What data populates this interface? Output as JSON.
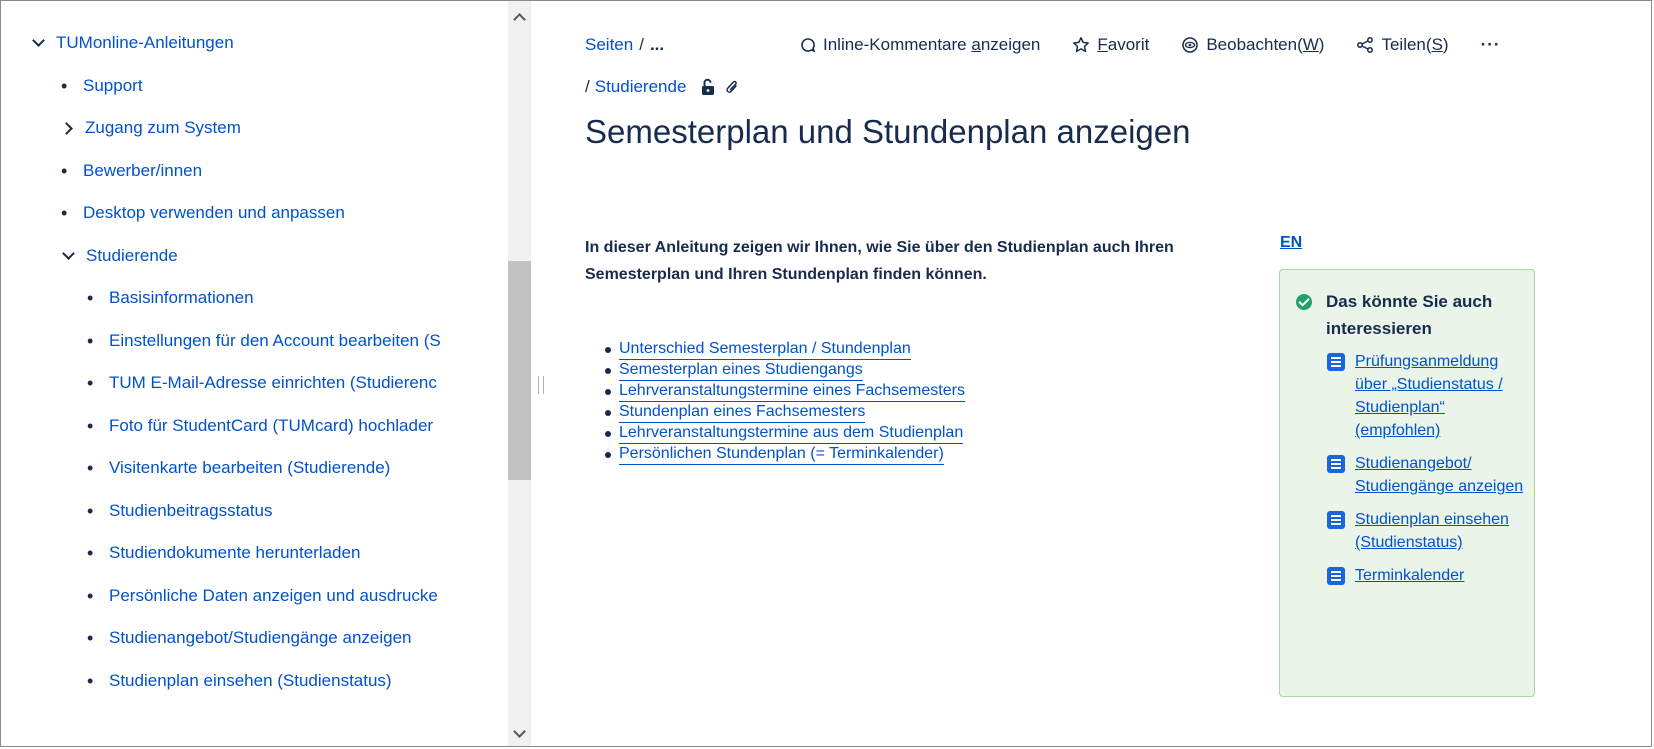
{
  "sidebar": {
    "items": [
      {
        "label": "TUMonline-Anleitungen",
        "marker": "expanded"
      },
      {
        "label": "Support",
        "marker": "bullet"
      },
      {
        "label": "Zugang zum System",
        "marker": "collapsed"
      },
      {
        "label": "Bewerber/innen",
        "marker": "bullet"
      },
      {
        "label": "Desktop verwenden und anpassen",
        "marker": "bullet"
      },
      {
        "label": "Studierende",
        "marker": "expanded"
      },
      {
        "label": "Basisinformationen",
        "marker": "bullet"
      },
      {
        "label": "Einstellungen für den Account bearbeiten (S",
        "marker": "bullet"
      },
      {
        "label": "TUM E-Mail-Adresse einrichten (Studierenc",
        "marker": "bullet"
      },
      {
        "label": "Foto für StudentCard (TUMcard) hochlader",
        "marker": "bullet"
      },
      {
        "label": "Visitenkarte bearbeiten (Studierende)",
        "marker": "bullet"
      },
      {
        "label": "Studienbeitragsstatus",
        "marker": "bullet"
      },
      {
        "label": "Studiendokumente herunterladen",
        "marker": "bullet"
      },
      {
        "label": "Persönliche Daten anzeigen und ausdrucke",
        "marker": "bullet"
      },
      {
        "label": "Studienangebot/Studiengänge anzeigen",
        "marker": "bullet"
      },
      {
        "label": "Studienplan einsehen (Studienstatus)",
        "marker": "bullet"
      }
    ]
  },
  "breadcrumb": {
    "root": "Seiten",
    "separator": "/",
    "ellipsis": "...",
    "parent": "Studierende"
  },
  "toolbar": {
    "inline_comments": {
      "pre": "Inline-Kommentare ",
      "key": "a",
      "post": "nzeigen"
    },
    "favorite": {
      "pre": "",
      "key": "F",
      "post": "avorit"
    },
    "watch": {
      "pre": "Beobachten(",
      "key": "W",
      "post": ")"
    },
    "share": {
      "pre": "Teilen(",
      "key": "S",
      "post": ")"
    },
    "more": "···"
  },
  "page": {
    "title": "Semesterplan und Stundenplan anzeigen",
    "intro": "In dieser Anleitung zeigen wir Ihnen, wie Sie über den Studienplan auch Ihren Semesterplan und Ihren Stundenplan finden können.",
    "toc": [
      "Unterschied Semesterplan / Stundenplan",
      "Semesterplan eines Studiengangs",
      "Lehrveranstaltungstermine eines Fachsemesters",
      "Stundenplan eines Fachsemesters",
      "Lehrveranstaltungstermine aus dem Studienplan",
      "Persönlichen Stundenplan (= Terminkalender)"
    ],
    "language_link": "EN"
  },
  "related": {
    "heading": "Das könnte Sie auch interessieren",
    "items": [
      "Prüfungsanmeldung über „Studienstatus / Studienplan“ (empfohlen)",
      "Studienangebot/ Studiengänge anzeigen",
      "Studienplan einsehen (Studienstatus)",
      "Terminkalender"
    ]
  },
  "colors": {
    "link": "#0052cc",
    "text": "#172b4d",
    "related_bg": "#eaf4e9",
    "check": "#22a06b",
    "page_icon": "#1868db"
  }
}
